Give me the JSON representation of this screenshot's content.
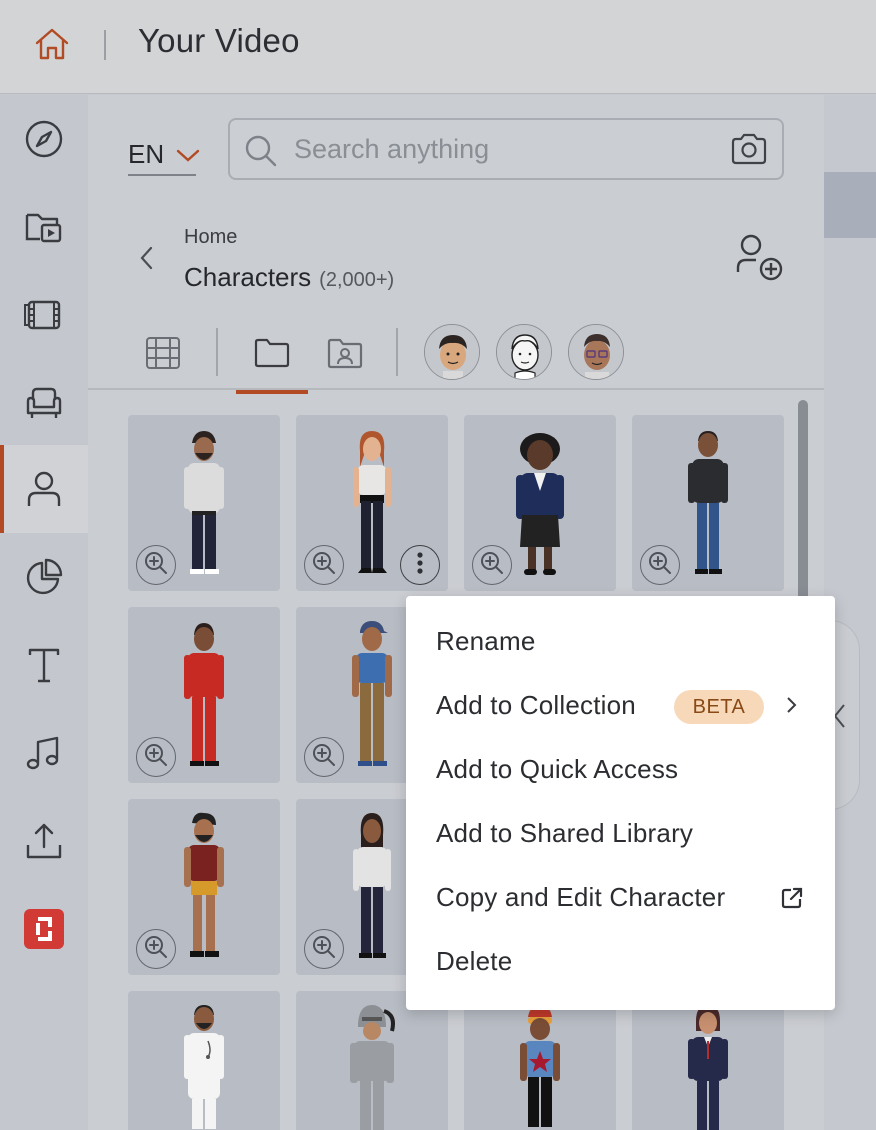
{
  "header": {
    "title": "Your Video",
    "home_icon": "home-icon"
  },
  "rail": {
    "items": [
      {
        "name": "compass-icon",
        "active": false
      },
      {
        "name": "folder-video-icon",
        "active": false
      },
      {
        "name": "film-icon",
        "active": false
      },
      {
        "name": "armchair-icon",
        "active": false
      },
      {
        "name": "person-icon",
        "active": true
      },
      {
        "name": "pie-chart-icon",
        "active": false
      },
      {
        "name": "text-icon",
        "active": false
      },
      {
        "name": "music-icon",
        "active": false
      },
      {
        "name": "upload-icon",
        "active": false
      },
      {
        "name": "brand-logo-icon",
        "active": false
      }
    ],
    "accent": "#b24a24",
    "brand_color": "#d23a36"
  },
  "language": {
    "value": "EN"
  },
  "search": {
    "placeholder": "Search anything"
  },
  "breadcrumb": {
    "parent": "Home",
    "title": "Characters",
    "count": "(2,000+)"
  },
  "tabs": [
    "grid-view-icon",
    "folder-icon",
    "contact-folder-icon"
  ],
  "context_menu": {
    "items": {
      "rename": "Rename",
      "add_to_collection": "Add to Collection",
      "beta": "BETA",
      "add_to_quick_access": "Add to Quick Access",
      "add_to_shared_library": "Add to Shared Library",
      "copy_and_edit": "Copy and Edit Character",
      "delete": "Delete"
    }
  }
}
